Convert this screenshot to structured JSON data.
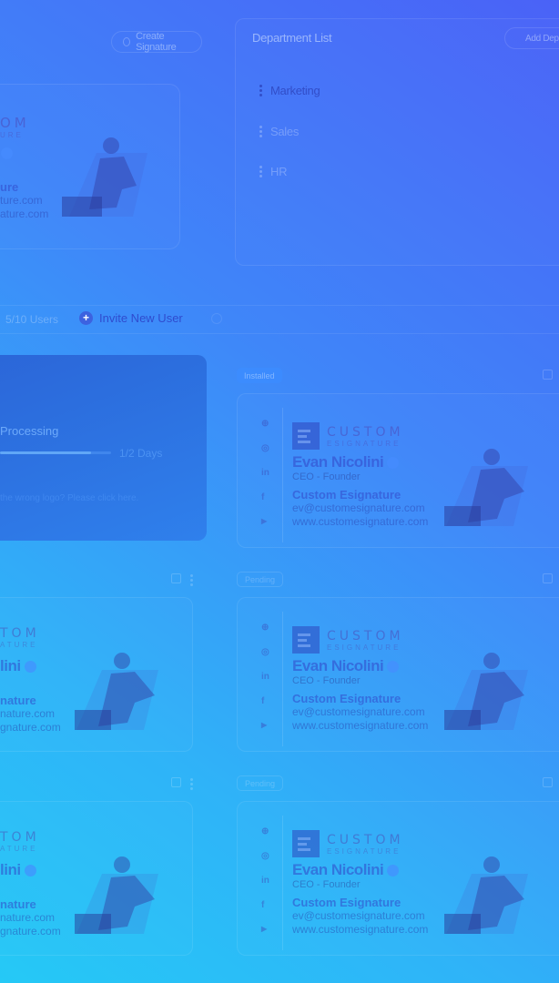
{
  "header": {
    "create_signature_label": "Create Signature"
  },
  "department": {
    "title": "Department List",
    "add_label": "Add Dep",
    "items": [
      {
        "label": "Marketing"
      },
      {
        "label": "Sales"
      },
      {
        "label": "HR"
      }
    ]
  },
  "users_bar": {
    "count": "5/10 Users",
    "invite_label": "Invite New User"
  },
  "processing": {
    "status": "Processing",
    "days": "1/2 Days",
    "progress": 0.82,
    "help_text": "the wrong logo? Please click here."
  },
  "signature": {
    "logo_main": "CUSTOM",
    "logo_sub": "ESIGNATURE",
    "name": "Evan Nicolini",
    "role": "CEO - Founder",
    "company": "Custom Esignature",
    "email": "ev@customesignature.com",
    "website": "www.customesignature.com"
  },
  "left_fragments": {
    "logo_main": "OM",
    "logo_sub": "URE",
    "company": "ure",
    "email": "ture.com",
    "website": "ature.com",
    "logo_main_2": "TOM",
    "logo_sub_2": "ATURE",
    "name": "lini",
    "company_2": "nature",
    "email_2": "nature.com",
    "website_2": "gnature.com"
  },
  "badges": {
    "installed": "Installed",
    "pending": "Pending"
  },
  "social_labels": {
    "web": "⊕",
    "instagram": "◎",
    "linkedin": "in",
    "facebook": "f",
    "youtube": "▶"
  },
  "colors": {
    "accent": "#3d6bff",
    "processing_card": "#2f70e0"
  }
}
